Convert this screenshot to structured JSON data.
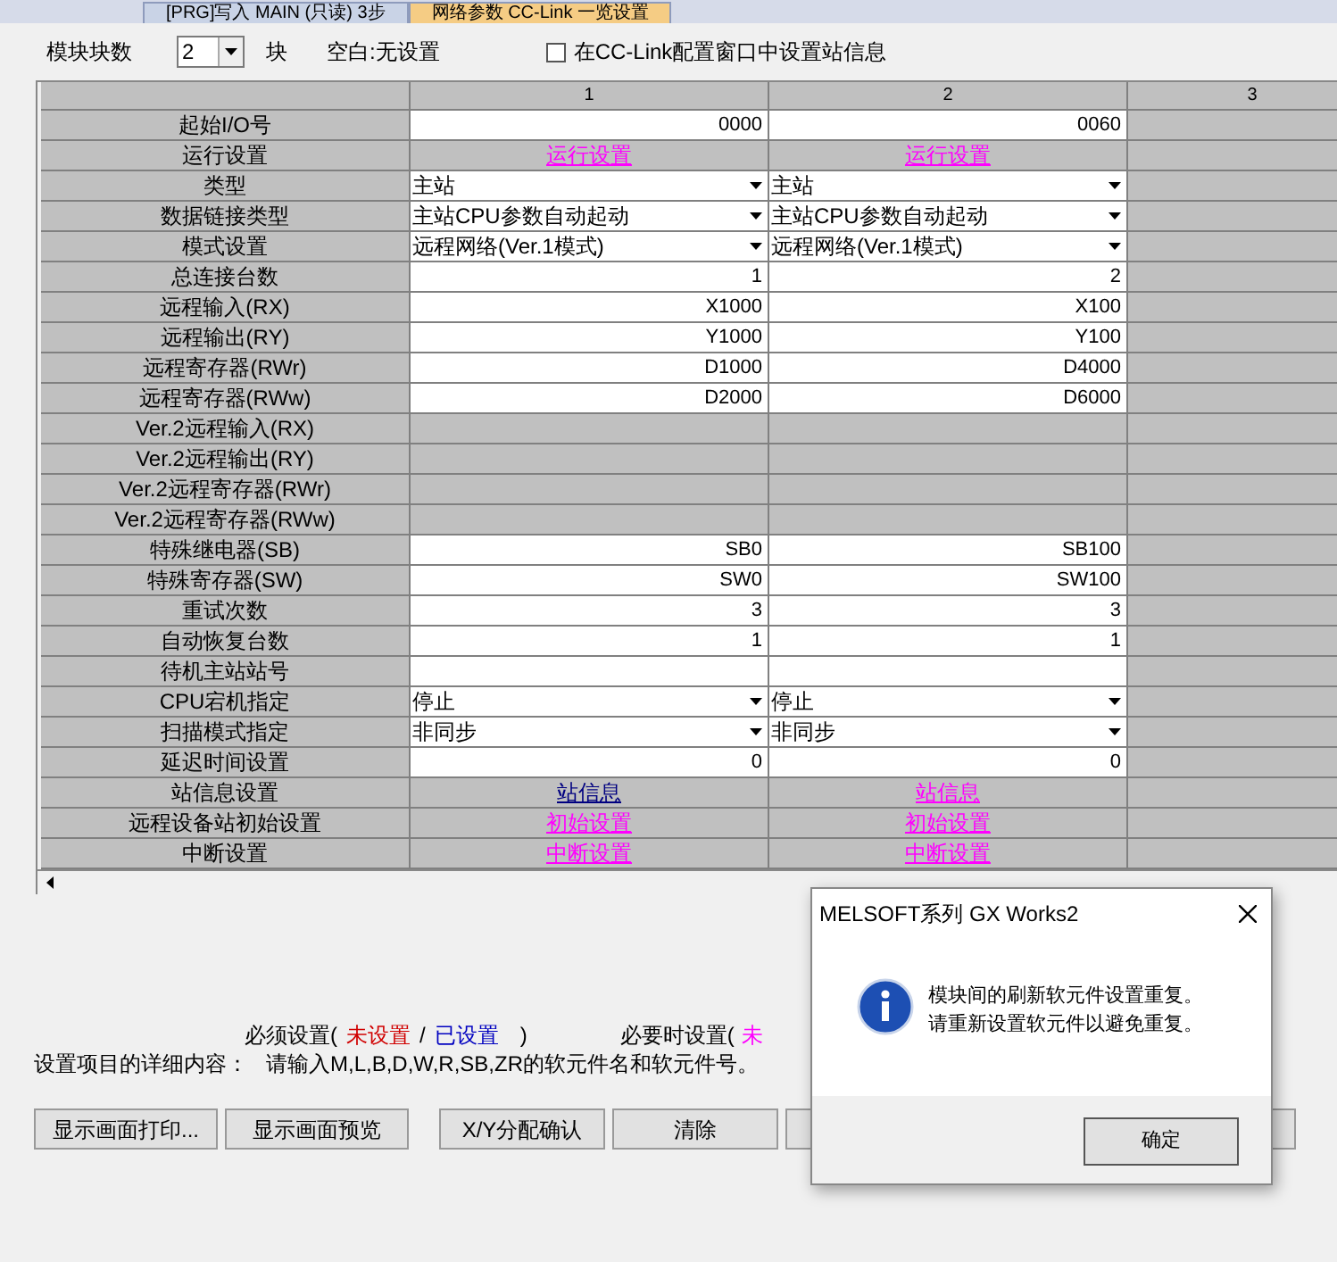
{
  "tabs": [
    {
      "label": "[PRG]写入 MAIN (只读) 3步",
      "selected": false
    },
    {
      "label": "网络参数 CC-Link 一览设置",
      "selected": true
    }
  ],
  "toolbar": {
    "module_count_label": "模块块数",
    "module_count": "2",
    "unit": "块",
    "blank_note": "空白:无设置",
    "station_info_checkbox": {
      "label": "在CC-Link配置窗口中设置站信息",
      "checked": false
    }
  },
  "table": {
    "columns": [
      "1",
      "2",
      "3"
    ],
    "rows": [
      {
        "label": "起始I/O号",
        "cells": [
          {
            "kind": "value",
            "text": "0000"
          },
          {
            "kind": "value",
            "text": "0060"
          }
        ]
      },
      {
        "label": "运行设置",
        "cells": [
          {
            "kind": "link",
            "text": "运行设置",
            "configured": false
          },
          {
            "kind": "link",
            "text": "运行设置",
            "configured": false
          }
        ]
      },
      {
        "label": "类型",
        "cells": [
          {
            "kind": "select",
            "text": "主站"
          },
          {
            "kind": "select",
            "text": "主站"
          }
        ]
      },
      {
        "label": "数据链接类型",
        "cells": [
          {
            "kind": "select",
            "text": "主站CPU参数自动起动"
          },
          {
            "kind": "select",
            "text": "主站CPU参数自动起动"
          }
        ]
      },
      {
        "label": "模式设置",
        "cells": [
          {
            "kind": "select",
            "text": "远程网络(Ver.1模式)"
          },
          {
            "kind": "select",
            "text": "远程网络(Ver.1模式)"
          }
        ]
      },
      {
        "label": "总连接台数",
        "cells": [
          {
            "kind": "value",
            "text": "1"
          },
          {
            "kind": "value",
            "text": "2"
          }
        ]
      },
      {
        "label": "远程输入(RX)",
        "cells": [
          {
            "kind": "value",
            "text": "X1000"
          },
          {
            "kind": "value",
            "text": "X100"
          }
        ]
      },
      {
        "label": "远程输出(RY)",
        "cells": [
          {
            "kind": "value",
            "text": "Y1000"
          },
          {
            "kind": "value",
            "text": "Y100"
          }
        ]
      },
      {
        "label": "远程寄存器(RWr)",
        "cells": [
          {
            "kind": "value",
            "text": "D1000"
          },
          {
            "kind": "value",
            "text": "D4000"
          }
        ]
      },
      {
        "label": "远程寄存器(RWw)",
        "cells": [
          {
            "kind": "value",
            "text": "D2000"
          },
          {
            "kind": "value",
            "text": "D6000"
          }
        ]
      },
      {
        "label": "Ver.2远程输入(RX)",
        "cells": [
          {
            "kind": "disabled"
          },
          {
            "kind": "disabled"
          }
        ]
      },
      {
        "label": "Ver.2远程输出(RY)",
        "cells": [
          {
            "kind": "disabled"
          },
          {
            "kind": "disabled"
          }
        ]
      },
      {
        "label": "Ver.2远程寄存器(RWr)",
        "cells": [
          {
            "kind": "disabled"
          },
          {
            "kind": "disabled"
          }
        ]
      },
      {
        "label": "Ver.2远程寄存器(RWw)",
        "cells": [
          {
            "kind": "disabled"
          },
          {
            "kind": "disabled"
          }
        ]
      },
      {
        "label": "特殊继电器(SB)",
        "cells": [
          {
            "kind": "value",
            "text": "SB0"
          },
          {
            "kind": "value",
            "text": "SB100"
          }
        ]
      },
      {
        "label": "特殊寄存器(SW)",
        "cells": [
          {
            "kind": "value",
            "text": "SW0"
          },
          {
            "kind": "value",
            "text": "SW100"
          }
        ]
      },
      {
        "label": "重试次数",
        "cells": [
          {
            "kind": "value",
            "text": "3"
          },
          {
            "kind": "value",
            "text": "3"
          }
        ]
      },
      {
        "label": "自动恢复台数",
        "cells": [
          {
            "kind": "value",
            "text": "1"
          },
          {
            "kind": "value",
            "text": "1"
          }
        ]
      },
      {
        "label": "待机主站站号",
        "cells": [
          {
            "kind": "empty"
          },
          {
            "kind": "empty"
          }
        ]
      },
      {
        "label": "CPU宕机指定",
        "cells": [
          {
            "kind": "select",
            "text": "停止"
          },
          {
            "kind": "select",
            "text": "停止"
          }
        ]
      },
      {
        "label": "扫描模式指定",
        "cells": [
          {
            "kind": "select",
            "text": "非同步"
          },
          {
            "kind": "select",
            "text": "非同步"
          }
        ]
      },
      {
        "label": "延迟时间设置",
        "cells": [
          {
            "kind": "value",
            "text": "0"
          },
          {
            "kind": "value",
            "text": "0"
          }
        ]
      },
      {
        "label": "站信息设置",
        "cells": [
          {
            "kind": "link",
            "text": "站信息",
            "configured": true
          },
          {
            "kind": "link",
            "text": "站信息",
            "configured": false
          }
        ]
      },
      {
        "label": "远程设备站初始设置",
        "cells": [
          {
            "kind": "link",
            "text": "初始设置",
            "configured": false
          },
          {
            "kind": "link",
            "text": "初始设置",
            "configured": false
          }
        ]
      },
      {
        "label": "中断设置",
        "cells": [
          {
            "kind": "link",
            "text": "中断设置",
            "configured": false
          },
          {
            "kind": "link",
            "text": "中断设置",
            "configured": false
          }
        ]
      }
    ]
  },
  "legend": {
    "required_label": "必须设置(",
    "unset": "未设置",
    "slash": "/",
    "set": "已设置",
    "close": ")",
    "optional_label": "必要时设置(",
    "optional_unset": "未"
  },
  "detail": {
    "label": "设置项目的详细内容：",
    "text": "请输入M,L,B,D,W,R,SB,ZR的软元件名和软元件号。"
  },
  "buttons": [
    {
      "kind": "text",
      "label": "显示画面打印..."
    },
    {
      "kind": "text",
      "label": "显示画面预览"
    },
    {
      "kind": "text",
      "label": "X/Y分配确认"
    },
    {
      "kind": "text",
      "label": "清除"
    },
    {
      "kind": "blank"
    },
    {
      "kind": "blank"
    }
  ],
  "dialog": {
    "title": "MELSOFT系列 GX Works2",
    "message": [
      "模块间的刷新软元件设置重复。",
      "请重新设置软元件以避免重复。"
    ],
    "button": "确定"
  }
}
